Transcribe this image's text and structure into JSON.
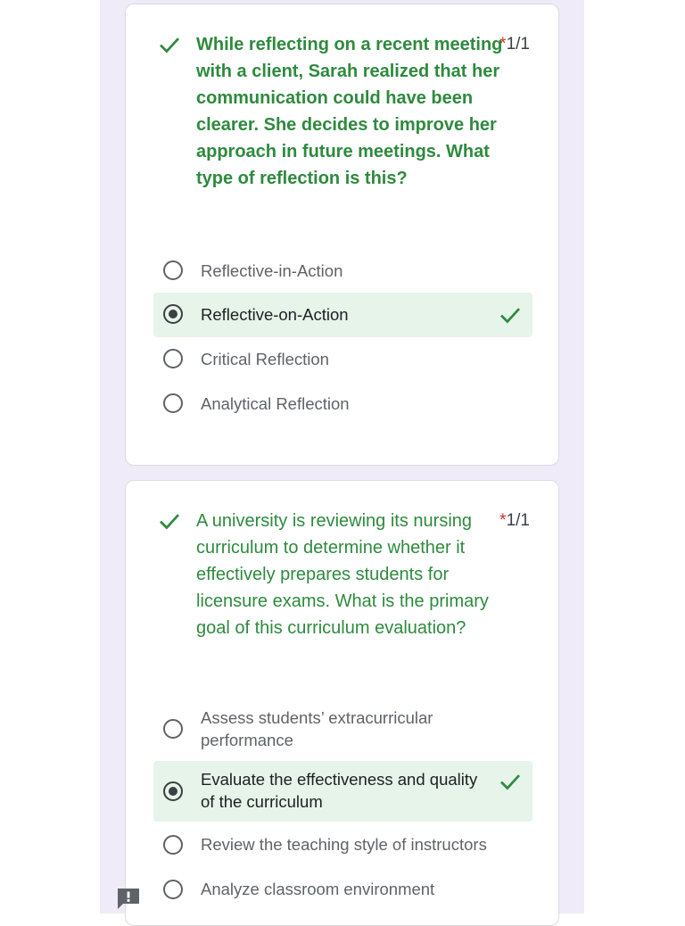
{
  "questions": [
    {
      "text": "While reflecting on a recent meeting with a client, Sarah realized that her communication could have been clearer. She decides to improve her approach in future meetings. What type of reflection is this?",
      "required_mark": "*",
      "score": "1/1",
      "options": [
        {
          "label": "Reflective-in-Action",
          "selected": false,
          "correct": false
        },
        {
          "label": "Reflective-on-Action",
          "selected": true,
          "correct": true
        },
        {
          "label": "Critical Reflection",
          "selected": false,
          "correct": false
        },
        {
          "label": "Analytical Reflection",
          "selected": false,
          "correct": false
        }
      ]
    },
    {
      "text": "A university is reviewing its nursing curriculum to determine whether it effectively prepares students for licensure exams. What is the primary goal of this curriculum evaluation?",
      "required_mark": "*",
      "score": "1/1",
      "options": [
        {
          "label": "Assess students’ extracurricular performance",
          "selected": false,
          "correct": false
        },
        {
          "label": "Evaluate the effectiveness and quality of the curriculum",
          "selected": true,
          "correct": true
        },
        {
          "label": "Review the teaching style of instructors",
          "selected": false,
          "correct": false
        },
        {
          "label": "Analyze classroom environment",
          "selected": false,
          "correct": false
        }
      ]
    }
  ],
  "colors": {
    "correct_green": "#2e8a3e",
    "correct_bg": "#e6f4ea",
    "required_red": "#d93025",
    "page_bg": "#f0ebf8"
  },
  "icons": {
    "question_status": "checkmark-icon",
    "option_correct": "checkmark-icon",
    "feedback": "report-problem-icon"
  }
}
